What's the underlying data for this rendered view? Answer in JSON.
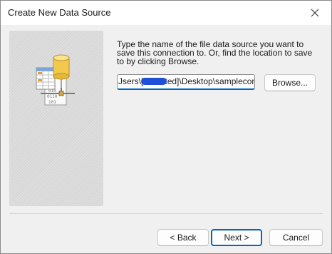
{
  "window": {
    "title": "Create New Data Source"
  },
  "instruction": {
    "text": "Type the name of the file data source you want to save this connection to.  Or, find the location to save to by clicking Browse."
  },
  "path_field": {
    "value": "Jsers\\[redacted]\\Desktop\\sampleconn.dsn"
  },
  "buttons": {
    "browse": "Browse...",
    "back": "< Back",
    "next": "Next >",
    "cancel": "Cancel"
  },
  "colors": {
    "accent": "#0067c0",
    "dialog_background": "#f0f0f0",
    "redaction": "#1e4fd8"
  },
  "icons": {
    "close": "close-icon",
    "illustration": "data-source-illustration"
  }
}
